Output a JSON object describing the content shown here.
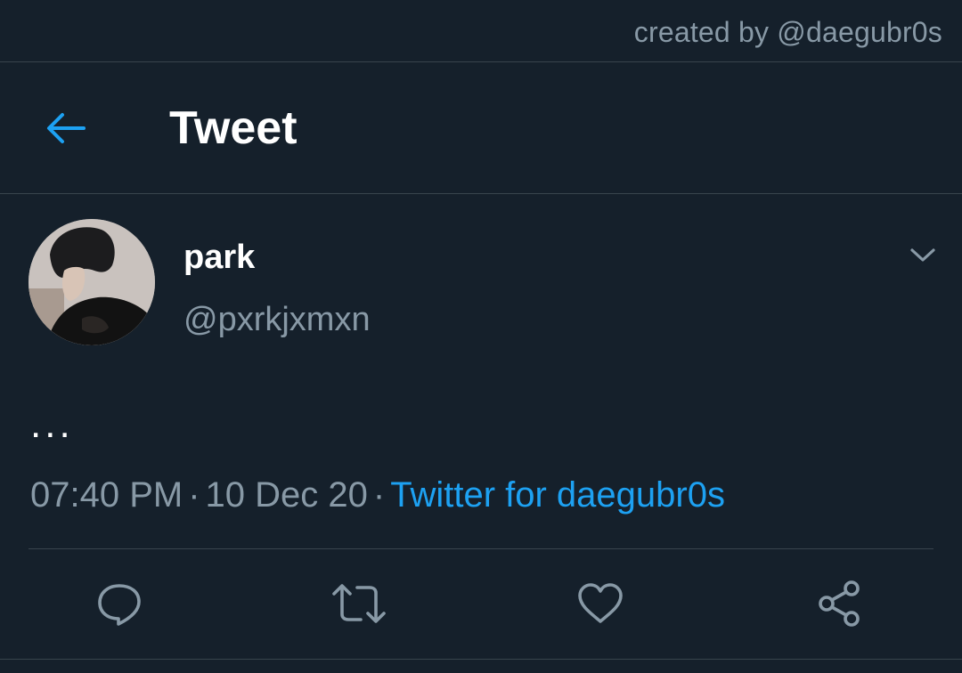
{
  "credit": {
    "text": "created by @daegubr0s"
  },
  "header": {
    "title": "Tweet",
    "back_icon": "arrow-left-icon",
    "accent_color": "#1da1f2"
  },
  "tweet": {
    "display_name": "park",
    "handle": "@pxrkjxmxn",
    "text": "...",
    "time": "07:40 PM",
    "date": "10 Dec 20",
    "separator": "·",
    "source": "Twitter for daegubr0s"
  },
  "actions": [
    {
      "name": "reply",
      "icon": "reply-icon"
    },
    {
      "name": "retweet",
      "icon": "retweet-icon"
    },
    {
      "name": "like",
      "icon": "heart-icon"
    },
    {
      "name": "share",
      "icon": "share-icon"
    }
  ],
  "colors": {
    "background": "#15202b",
    "border": "#38444d",
    "secondary_text": "#8899a6",
    "link": "#1da1f2"
  }
}
